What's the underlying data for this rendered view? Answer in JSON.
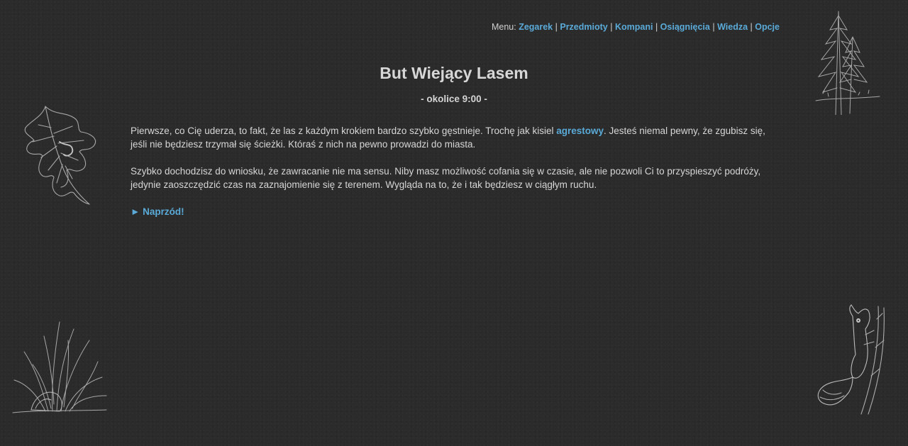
{
  "menu": {
    "prefix": "Menu:",
    "items": [
      {
        "label": "Zegarek"
      },
      {
        "label": "Przedmioty"
      },
      {
        "label": "Kompani"
      },
      {
        "label": "Osiągnięcia"
      },
      {
        "label": "Wiedza"
      },
      {
        "label": "Opcje"
      }
    ],
    "separator": "|"
  },
  "passage": {
    "title": "But Wiejący Lasem",
    "time": "- okolice 9:00 -",
    "paragraph1": {
      "before": "Pierwsze, co Cię uderza, to fakt, że las z każdym krokiem bardzo szybko gęstnieje. Trochę jak kisiel ",
      "link": "agrestowy",
      "after": ". Jesteś niemal pewny, że zgubisz się, jeśli nie będziesz trzymał się ścieżki. Któraś z nich na pewno prowadzi do miasta."
    },
    "paragraph2": "Szybko dochodzisz do wniosku, że zawracanie nie ma sensu. Niby masz możliwość cofania się w czasie, ale nie pozwoli Ci to przyspieszyć podróży, jedynie zaoszczędzić czas na zaznajomienie się z terenem. Wygląda na to, że i tak będziesz w ciągłym ruchu.",
    "next_link": "► Naprzód!"
  },
  "decorations": {
    "top_left": "oak-leaf-sketch-icon",
    "top_right": "pine-trees-sketch-icon",
    "bottom_left": "grass-sketch-icon",
    "bottom_right": "squirrel-sketch-icon"
  },
  "colors": {
    "background": "#2b2b2b",
    "text": "#d6d6d6",
    "link": "#5aaad8"
  }
}
